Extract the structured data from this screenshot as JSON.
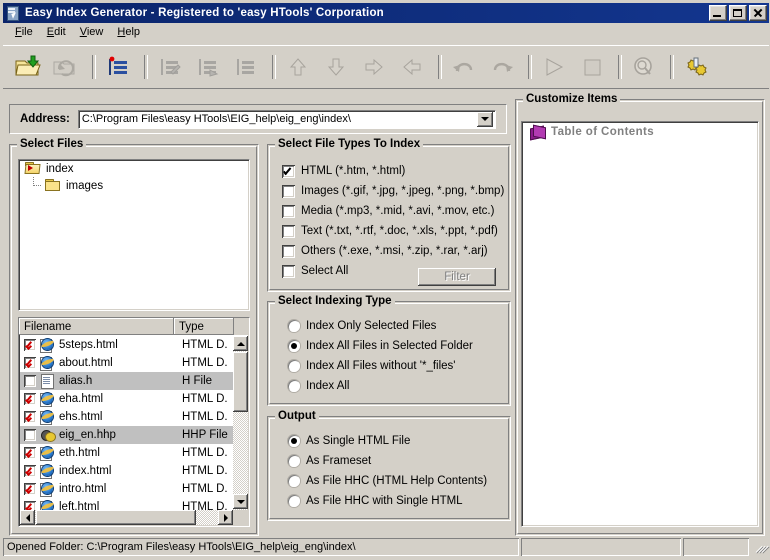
{
  "window": {
    "title": "Easy Index Generator -  Registered to 'easy HTools' Corporation",
    "app_icon": "app-document-icon",
    "minimize_label": "",
    "maximize_label": "",
    "close_label": ""
  },
  "menu": {
    "items": [
      {
        "label": "File",
        "accel": "F"
      },
      {
        "label": "Edit",
        "accel": "E"
      },
      {
        "label": "View",
        "accel": "V"
      },
      {
        "label": "Help",
        "accel": "H"
      }
    ]
  },
  "toolbar": {
    "buttons": [
      {
        "name": "open-folder-icon",
        "enabled": true
      },
      {
        "name": "refresh-icon",
        "enabled": false
      },
      {
        "name": "new-index-item-icon",
        "enabled": true
      },
      {
        "name": "edit-item-icon",
        "enabled": false
      },
      {
        "name": "delete-item-icon",
        "enabled": false
      },
      {
        "name": "list-items-icon",
        "enabled": false
      },
      {
        "name": "move-up-icon",
        "enabled": false
      },
      {
        "name": "move-down-icon",
        "enabled": false
      },
      {
        "name": "move-right-icon",
        "enabled": false
      },
      {
        "name": "move-left-icon",
        "enabled": false
      },
      {
        "name": "undo-icon",
        "enabled": false
      },
      {
        "name": "redo-icon",
        "enabled": false
      },
      {
        "name": "run-icon",
        "enabled": false
      },
      {
        "name": "stop-icon",
        "enabled": false
      },
      {
        "name": "preview-icon",
        "enabled": false
      },
      {
        "name": "options-gears-icon",
        "enabled": true
      }
    ]
  },
  "address": {
    "label": "Address:",
    "value": "C:\\Program Files\\easy HTools\\EIG_help\\eig_eng\\index\\"
  },
  "select_files": {
    "title": "Select Files",
    "tree": [
      {
        "label": "index",
        "icon": "folder-open-icon",
        "level": 0
      },
      {
        "label": "images",
        "icon": "folder-icon",
        "level": 1
      }
    ],
    "columns": [
      "Filename",
      "Type"
    ],
    "rows": [
      {
        "checked": true,
        "name": "5steps.html",
        "type": "HTML D.",
        "icon": "html-file-icon",
        "selected": false
      },
      {
        "checked": true,
        "name": "about.html",
        "type": "HTML D.",
        "icon": "html-file-icon",
        "selected": false
      },
      {
        "checked": false,
        "name": "alias.h",
        "type": "H File",
        "icon": "h-file-icon",
        "selected": true
      },
      {
        "checked": true,
        "name": "eha.html",
        "type": "HTML D.",
        "icon": "html-file-icon",
        "selected": false
      },
      {
        "checked": true,
        "name": "ehs.html",
        "type": "HTML D.",
        "icon": "html-file-icon",
        "selected": false
      },
      {
        "checked": false,
        "name": "eig_en.hhp",
        "type": "HHP File",
        "icon": "hhp-file-icon",
        "selected": true
      },
      {
        "checked": true,
        "name": "eth.html",
        "type": "HTML D.",
        "icon": "html-file-icon",
        "selected": false
      },
      {
        "checked": true,
        "name": "index.html",
        "type": "HTML D.",
        "icon": "html-file-icon",
        "selected": false
      },
      {
        "checked": true,
        "name": "intro.html",
        "type": "HTML D.",
        "icon": "html-file-icon",
        "selected": false
      },
      {
        "checked": true,
        "name": "left.html",
        "type": "HTML D.",
        "icon": "html-file-icon",
        "selected": false
      }
    ]
  },
  "file_types": {
    "title": "Select File Types To Index",
    "options": [
      {
        "label": "HTML (*.htm, *.html)",
        "checked": true
      },
      {
        "label": "Images (*.gif, *.jpg, *.jpeg, *.png, *.bmp)",
        "checked": false
      },
      {
        "label": "Media (*.mp3, *.mid, *.avi, *.mov, etc.)",
        "checked": false
      },
      {
        "label": "Text (*.txt, *.rtf, *.doc, *.xls, *.ppt, *.pdf)",
        "checked": false
      },
      {
        "label": "Others (*.exe, *.msi, *.zip, *.rar, *.arj)",
        "checked": false
      },
      {
        "label": "Select All",
        "checked": false
      }
    ],
    "filter_button": {
      "label": "Filter",
      "enabled": false
    }
  },
  "indexing_type": {
    "title": "Select Indexing Type",
    "options": [
      {
        "label": "Index Only Selected Files",
        "selected": false
      },
      {
        "label": "Index All Files in Selected Folder",
        "selected": true
      },
      {
        "label": "Index All Files without '*_files'",
        "selected": false
      },
      {
        "label": "Index All",
        "selected": false
      }
    ]
  },
  "output": {
    "title": "Output",
    "options": [
      {
        "label": "As Single HTML File",
        "selected": true
      },
      {
        "label": "As Frameset",
        "selected": false
      },
      {
        "label": "As File HHC (HTML Help Contents)",
        "selected": false
      },
      {
        "label": "As File HHC with Single HTML",
        "selected": false
      }
    ]
  },
  "customize_items": {
    "title": "Customize Items",
    "items": [
      {
        "label": "Table of Contents",
        "icon": "book-icon",
        "disabled": true
      }
    ]
  },
  "statusbar": {
    "panels": [
      "Opened Folder: C:\\Program Files\\easy HTools\\EIG_help\\eig_eng\\index\\",
      "",
      ""
    ]
  },
  "colors": {
    "titlebar": "#0a246a",
    "face": "#d4d0c8",
    "selection": "#c0c0c0",
    "check_red": "#cc0000",
    "book_purple": "#8b1a8b"
  }
}
